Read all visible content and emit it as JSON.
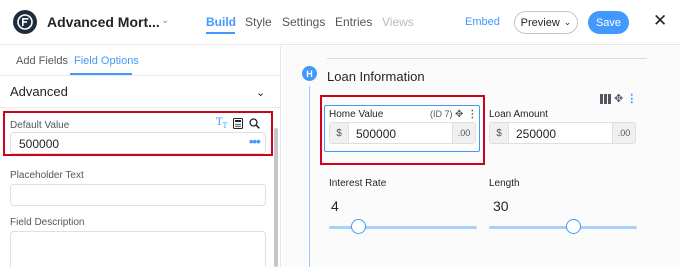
{
  "app": {
    "form_title": "Advanced Mort...",
    "nav": {
      "build": "Build",
      "style": "Style",
      "settings": "Settings",
      "entries": "Entries",
      "views": "Views"
    },
    "embed": "Embed",
    "preview": "Preview",
    "save": "Save"
  },
  "left": {
    "tabs": {
      "add_fields": "Add Fields",
      "field_options": "Field Options"
    },
    "section": "Advanced",
    "default_value": {
      "label": "Default Value",
      "value": "500000"
    },
    "placeholder_text": {
      "label": "Placeholder Text",
      "value": ""
    },
    "field_description": {
      "label": "Field Description",
      "value": ""
    }
  },
  "canvas": {
    "badge": "H",
    "section_title": "Loan Information",
    "home_value": {
      "label": "Home Value",
      "id": "(ID 7)",
      "prefix": "$",
      "value": "500000",
      "suffix": ".00"
    },
    "loan_amount": {
      "label": "Loan Amount",
      "prefix": "$",
      "value": "250000",
      "suffix": ".00"
    },
    "interest_rate": {
      "label": "Interest Rate",
      "value": "4",
      "position": 0.2
    },
    "length": {
      "label": "Length",
      "value": "30",
      "position": 0.57
    }
  },
  "colors": {
    "accent": "#4199fd",
    "highlight": "#d0021b"
  },
  "icons": [
    "logo-icon",
    "chevron-down-icon",
    "close-icon",
    "text-format-icon",
    "calculator-icon",
    "search-icon",
    "more-dots-icon",
    "columns-icon",
    "move-icon",
    "vertical-dots-icon"
  ]
}
